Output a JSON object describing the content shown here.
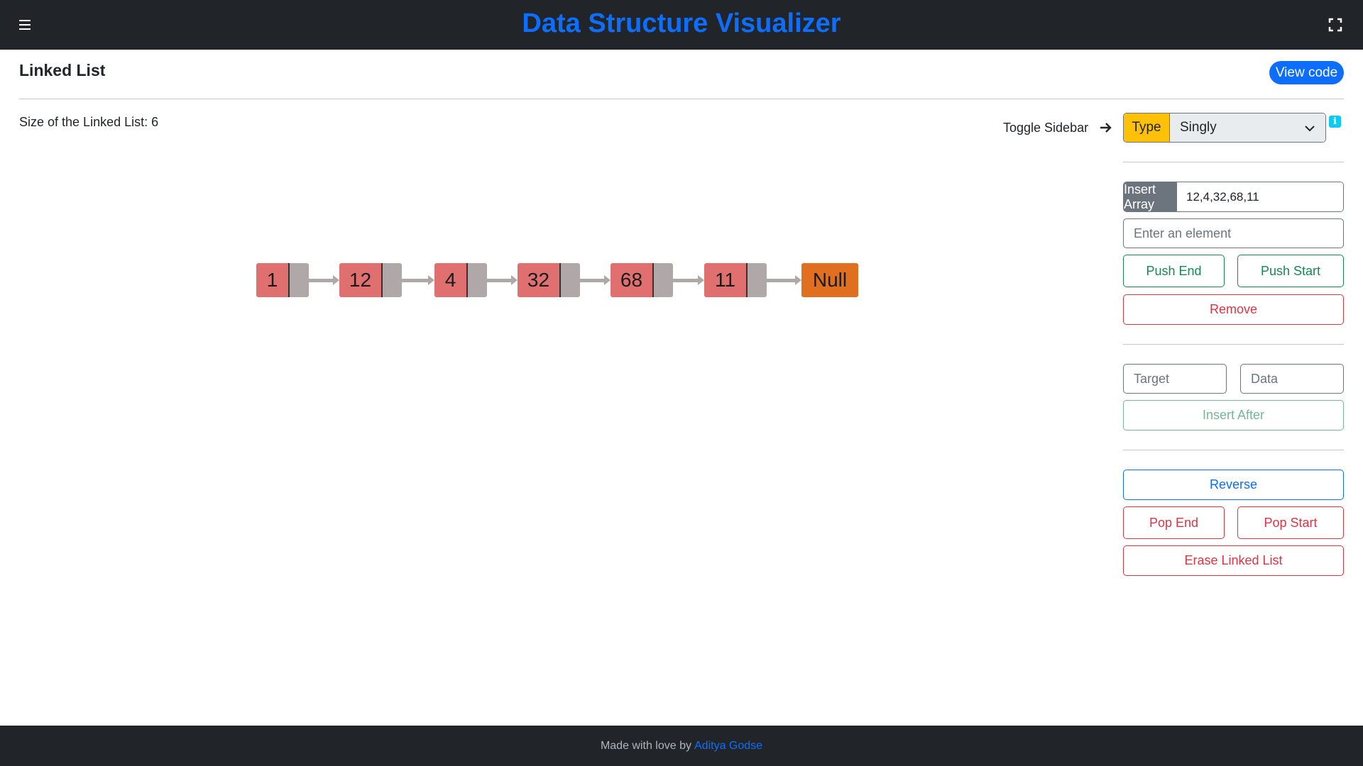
{
  "header": {
    "title": "Data Structure Visualizer",
    "menu_icon": "hamburger-icon",
    "fullscreen_icon": "fullscreen-icon"
  },
  "page": {
    "heading": "Linked List",
    "view_code_label": "View code",
    "size_label": "Size of the Linked List: 6"
  },
  "sidebar": {
    "toggle_label": "Toggle Sidebar",
    "type_label": "Type",
    "type_value": "Singly",
    "info_glyph": "i",
    "insert_array_label": "Insert Array",
    "insert_array_value": "12,4,32,68,11",
    "element_placeholder": "Enter an element",
    "push_end_label": "Push End",
    "push_start_label": "Push Start",
    "remove_label": "Remove",
    "target_placeholder": "Target",
    "data_placeholder": "Data",
    "insert_after_label": "Insert After",
    "reverse_label": "Reverse",
    "pop_end_label": "Pop End",
    "pop_start_label": "Pop Start",
    "erase_label": "Erase Linked List"
  },
  "linked_list": {
    "nodes": [
      "1",
      "12",
      "4",
      "32",
      "68",
      "11"
    ],
    "null_label": "Null"
  },
  "footer": {
    "text": "Made with love by",
    "author": "Aditya Godse"
  },
  "colors": {
    "accent": "#0d6efd",
    "node": "#e07070",
    "null_node": "#e0701f",
    "type_badge": "#ffc107"
  }
}
